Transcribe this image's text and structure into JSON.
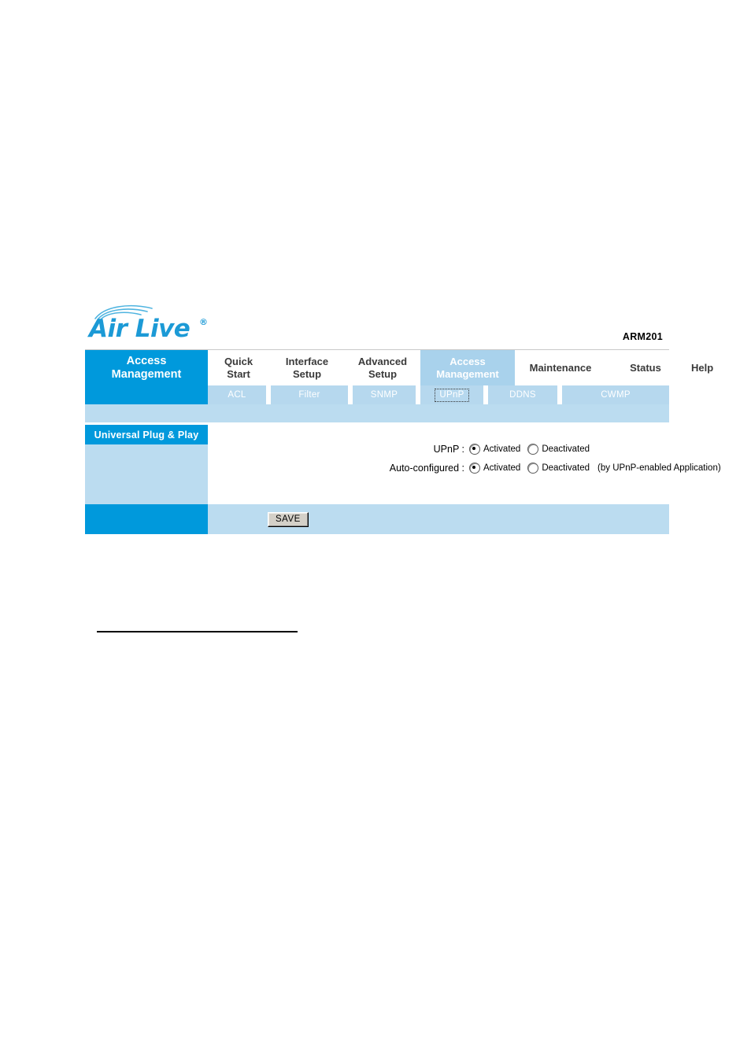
{
  "brand": {
    "logo_text": "Air Live",
    "logo_registered": "®",
    "model": "ARM201"
  },
  "nav": {
    "panel_title_line1": "Access",
    "panel_title_line2": "Management",
    "items": [
      {
        "line1": "Quick",
        "line2": "Start",
        "active": false
      },
      {
        "line1": "Interface",
        "line2": "Setup",
        "active": false
      },
      {
        "line1": "Advanced",
        "line2": "Setup",
        "active": false
      },
      {
        "line1": "Access",
        "line2": "Management",
        "active": true
      },
      {
        "line1": "Maintenance",
        "line2": "",
        "active": false
      },
      {
        "line1": "Status",
        "line2": "",
        "active": false
      },
      {
        "line1": "Help",
        "line2": "",
        "active": false
      }
    ]
  },
  "subtabs": {
    "items": [
      {
        "label": "ACL",
        "focused": false
      },
      {
        "label": "Filter",
        "focused": false
      },
      {
        "label": "SNMP",
        "focused": false
      },
      {
        "label": "UPnP",
        "focused": true
      },
      {
        "label": "DDNS",
        "focused": false
      },
      {
        "label": "CWMP",
        "focused": false
      }
    ]
  },
  "section": {
    "header": "Universal Plug & Play"
  },
  "form": {
    "rows": [
      {
        "label": "UPnP :",
        "options": [
          {
            "label": "Activated",
            "selected": true
          },
          {
            "label": "Deactivated",
            "selected": false
          }
        ],
        "hint": ""
      },
      {
        "label": "Auto-configured :",
        "options": [
          {
            "label": "Activated",
            "selected": true
          },
          {
            "label": "Deactivated",
            "selected": false
          }
        ],
        "hint": "(by UPnP-enabled Application)"
      }
    ]
  },
  "footer": {
    "save_label": "SAVE"
  },
  "colors": {
    "brand_blue": "#0099DC",
    "logo_blue": "#1C9AD6",
    "light_blue": "#BBDCF0",
    "subtab_blue": "#B6D8EE",
    "active_nav_blue": "#A9D2EC",
    "button_face": "#D4D0C8"
  }
}
